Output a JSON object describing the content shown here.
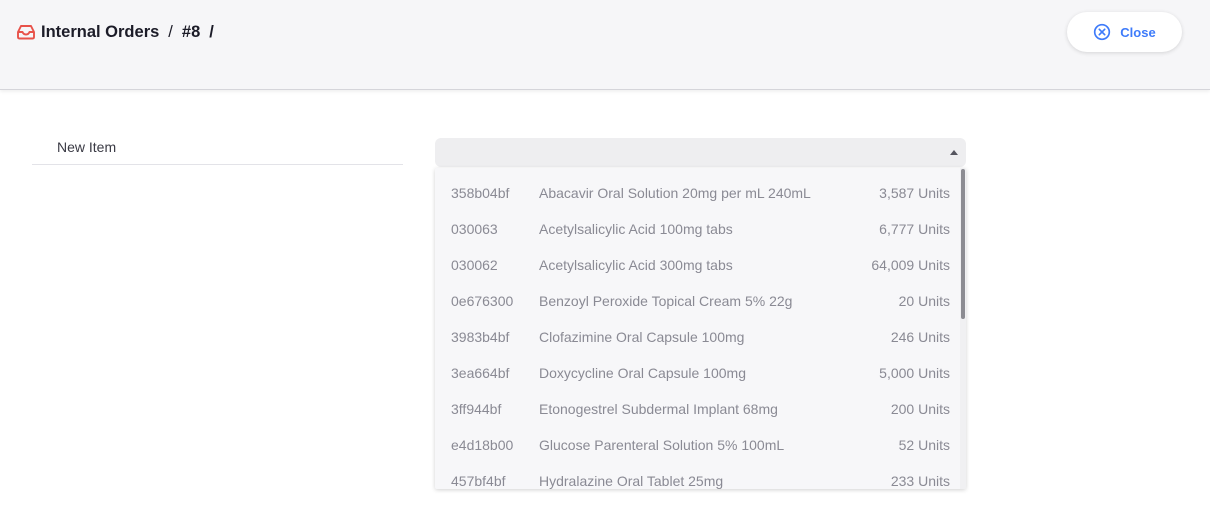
{
  "header": {
    "breadcrumb": [
      {
        "label": "Internal Orders"
      },
      {
        "label": "#8"
      }
    ],
    "separator": "/",
    "close_label": "Close",
    "accent_color": "#3e7bfa",
    "icon_color": "#e8524a"
  },
  "form": {
    "new_item_label": "New Item",
    "new_item_value": ""
  },
  "dropdown": {
    "items": [
      {
        "code": "358b04bf",
        "name": "Abacavir Oral Solution 20mg per mL 240mL",
        "qty": "3,587 Units"
      },
      {
        "code": "030063",
        "name": "Acetylsalicylic Acid 100mg tabs",
        "qty": "6,777 Units"
      },
      {
        "code": "030062",
        "name": "Acetylsalicylic Acid 300mg tabs",
        "qty": "64,009 Units"
      },
      {
        "code": "0e676300",
        "name": "Benzoyl Peroxide Topical Cream 5% 22g",
        "qty": "20 Units"
      },
      {
        "code": "3983b4bf",
        "name": "Clofazimine Oral Capsule 100mg",
        "qty": "246 Units"
      },
      {
        "code": "3ea664bf",
        "name": "Doxycycline Oral Capsule 100mg",
        "qty": "5,000 Units"
      },
      {
        "code": "3ff944bf",
        "name": "Etonogestrel Subdermal Implant 68mg",
        "qty": "200 Units"
      },
      {
        "code": "e4d18b00",
        "name": "Glucose Parenteral Solution 5% 100mL",
        "qty": "52 Units"
      },
      {
        "code": "457bf4bf",
        "name": "Hydralazine Oral Tablet 25mg",
        "qty": "233 Units"
      }
    ]
  }
}
